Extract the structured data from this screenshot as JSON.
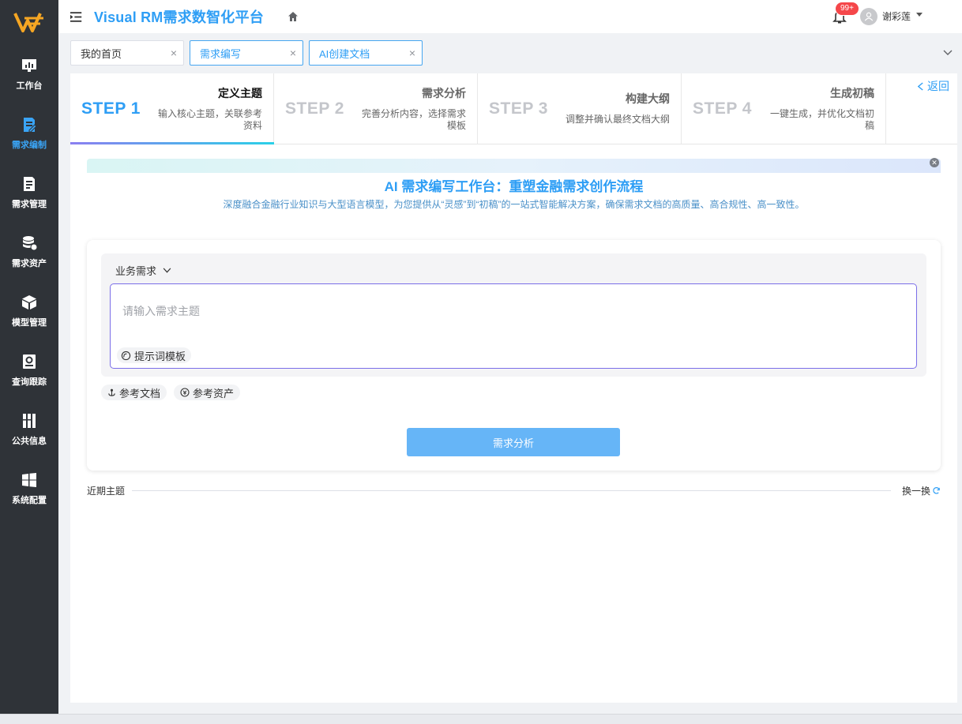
{
  "app": {
    "title": "Visual RM需求数智化平台"
  },
  "sidebar": {
    "items": [
      {
        "label": "工作台",
        "icon": "dashboard-icon"
      },
      {
        "label": "需求编制",
        "icon": "document-edit-icon",
        "active": true
      },
      {
        "label": "需求管理",
        "icon": "document-list-icon"
      },
      {
        "label": "需求资产",
        "icon": "database-icon"
      },
      {
        "label": "模型管理",
        "icon": "cube-icon"
      },
      {
        "label": "查询跟踪",
        "icon": "search-book-icon"
      },
      {
        "label": "公共信息",
        "icon": "info-columns-icon"
      },
      {
        "label": "系统配置",
        "icon": "windows-grid-icon"
      }
    ]
  },
  "header": {
    "notification_count": "99+",
    "user_name": "谢彩莲"
  },
  "tabs": [
    {
      "label": "我的首页",
      "close": "×"
    },
    {
      "label": "需求编写",
      "close": "×",
      "active": true
    },
    {
      "label": "AI创建文档",
      "close": "×",
      "active": true
    }
  ],
  "steps": [
    {
      "num": "STEP 1",
      "title": "定义主题",
      "desc_line1": "输入核心主题，关联参考",
      "desc_line2": "资料",
      "active": true
    },
    {
      "num": "STEP 2",
      "title": "需求分析",
      "desc_line1": "完善分析内容，选择需求",
      "desc_line2": "模板"
    },
    {
      "num": "STEP 3",
      "title": "构建大纲",
      "desc_line1": "调整并确认最终文档大纲",
      "desc_line2": ""
    },
    {
      "num": "STEP 4",
      "title": "生成初稿",
      "desc_line1": "一键生成，并优化文档初",
      "desc_line2": "稿"
    }
  ],
  "back_label": "返回",
  "banner": {
    "title": "AI 需求编写工作台：重塑金融需求创作流程",
    "subtitle": "深度融合金融行业知识与大型语言模型，为您提供从“灵感”到“初稿”的一站式智能解决方案，确保需求文档的高质量、高合规性、高一致性。"
  },
  "editor": {
    "req_type": "业务需求",
    "placeholder": "请输入需求主题",
    "prompt_template": "提示词模板",
    "ref_doc": "参考文档",
    "ref_asset": "参考资产",
    "submit": "需求分析"
  },
  "recent": {
    "label": "近期主题",
    "refresh": "换一换"
  },
  "colors": {
    "accent": "#2e9ef5",
    "sidebar_bg": "#2f3338",
    "badge": "#f5474a",
    "input_border": "#7b6ee8",
    "button": "#66b5f7"
  }
}
